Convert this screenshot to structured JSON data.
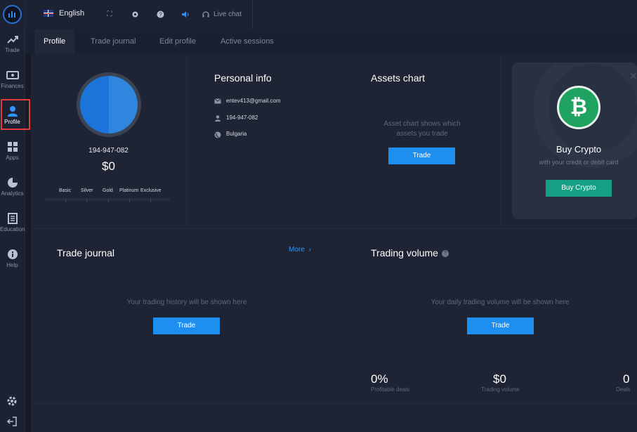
{
  "sidebar": {
    "items": [
      {
        "label": "Trade",
        "icon": "trend-up-icon"
      },
      {
        "label": "Finances",
        "icon": "wallet-icon"
      },
      {
        "label": "Profile",
        "icon": "user-icon",
        "active": true
      },
      {
        "label": "Apps",
        "icon": "grid-icon"
      },
      {
        "label": "Analytics",
        "icon": "pie-chart-icon"
      },
      {
        "label": "Education",
        "icon": "book-icon"
      },
      {
        "label": "Help",
        "icon": "info-icon"
      }
    ]
  },
  "topbar": {
    "language": "English",
    "live_chat": "Live chat"
  },
  "tabs": [
    {
      "label": "Profile",
      "active": true
    },
    {
      "label": "Trade journal"
    },
    {
      "label": "Edit profile"
    },
    {
      "label": "Active sessions"
    }
  ],
  "profile": {
    "user_id": "194-947-082",
    "balance": "$0",
    "levels": [
      "Basic",
      "Silver",
      "Gold",
      "Platinum",
      "Exclusive"
    ]
  },
  "personal_info": {
    "title": "Personal info",
    "email": "entev413@gmail.com",
    "id": "194-947-082",
    "country": "Bulgaria"
  },
  "assets_chart": {
    "title": "Assets chart",
    "description": "Asset chart shows which assets you trade",
    "button": "Trade"
  },
  "crypto": {
    "title": "Buy Crypto",
    "subtitle": "with your credit or debit card",
    "button": "Buy Crypto"
  },
  "trade_journal": {
    "title": "Trade journal",
    "more": "More",
    "empty": "Your trading history will be shown here",
    "button": "Trade"
  },
  "trading_volume": {
    "title": "Trading volume",
    "empty": "Your daily trading volume will be shown here",
    "button": "Trade",
    "stats": [
      {
        "value": "0%",
        "label": "Profitable deals"
      },
      {
        "value": "$0",
        "label": "Trading volume"
      },
      {
        "value": "0",
        "label": "Deals"
      }
    ]
  },
  "colors": {
    "accent": "#1f8ef1",
    "green": "#16a085",
    "highlight": "#e23b3b"
  }
}
